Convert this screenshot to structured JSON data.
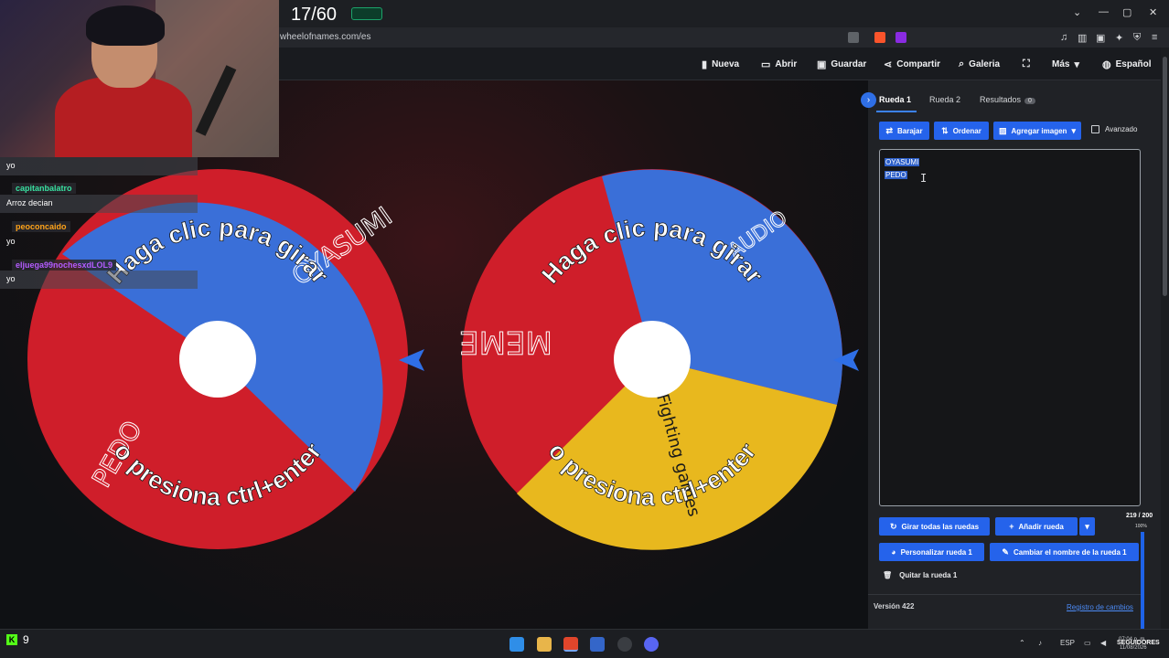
{
  "browser": {
    "url": "wheelofnames.com/es",
    "counter": "17/60"
  },
  "menu": {
    "items": [
      {
        "label": "Nueva",
        "icon": "file-icon"
      },
      {
        "label": "Abrir",
        "icon": "folder-icon"
      },
      {
        "label": "Guardar",
        "icon": "save-icon"
      },
      {
        "label": "Compartir",
        "icon": "share-icon"
      },
      {
        "label": "Galeria",
        "icon": "search-icon"
      },
      {
        "label": "Más",
        "icon": "chevron-down-icon"
      },
      {
        "label": "Español",
        "icon": "globe-icon"
      }
    ]
  },
  "chat": {
    "messages": [
      {
        "user": "",
        "text": "yo"
      },
      {
        "user": "capitanbalatro",
        "text": "Arroz decian",
        "color": "#38e0a0"
      },
      {
        "user": "peoconcaido",
        "text": "yo",
        "color": "#ffa31a"
      },
      {
        "user": "eljuega99nochesxdLOL9",
        "text": "yo",
        "color": "#b45cff"
      }
    ]
  },
  "wheels": [
    {
      "prompt_top": "Haga clic para girar",
      "prompt_bottom": "o presiona ctrl+enter",
      "entries": [
        "OYASUMI",
        "PEDO"
      ],
      "colors": [
        "#3a6fd8",
        "#cf1e2a"
      ]
    },
    {
      "prompt_top": "Haga clic para girar",
      "prompt_bottom": "o presiona ctrl+enter",
      "entries": [
        "AUDIO",
        "MEME",
        "Fighting games"
      ],
      "colors": [
        "#3a6fd8",
        "#cf1e2a",
        "#e8b81e"
      ]
    }
  ],
  "panel": {
    "tabs": [
      {
        "label": "Rueda 1",
        "active": true
      },
      {
        "label": "Rueda 2",
        "active": false
      },
      {
        "label": "Resultados",
        "badge": "0",
        "active": false
      }
    ],
    "toolbar": {
      "shuffle": "Barajar",
      "sort": "Ordenar",
      "add_image": "Agregar imagen",
      "advanced": "Avanzado"
    },
    "entries_text": [
      "OYASUMI",
      "PEDO"
    ],
    "count": "219 / 200",
    "zoom": "100%",
    "actions": {
      "spin_all": "Girar todas las ruedas",
      "add_wheel": "Añadir rueda",
      "customize": "Personalizar rueda 1",
      "rename": "Cambiar el nombre de la rueda 1",
      "remove": "Quitar la rueda 1"
    },
    "version": "Versión 422",
    "changelog": "Registro de cambios"
  },
  "taskbar": {
    "kick_count": "9",
    "lang": "ESP",
    "time": "07:04 p. m.",
    "date": "11/08/2026",
    "overlay": "SEGUIDORES"
  }
}
